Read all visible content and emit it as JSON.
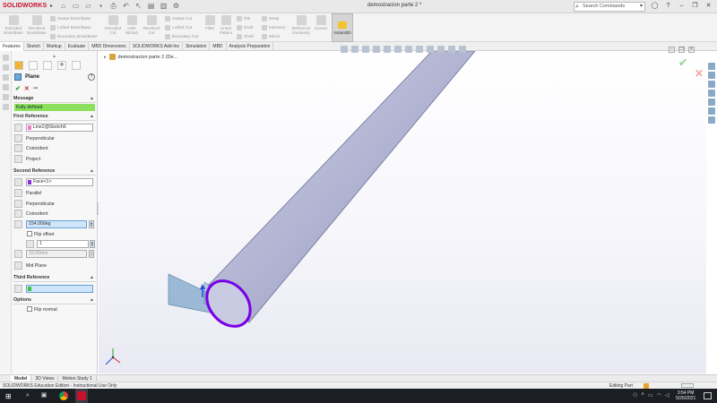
{
  "app": {
    "brand": "SOLIDWORKS",
    "document_title": "demostracion parte 2 *",
    "search_placeholder": "Search Commands"
  },
  "commands": {
    "extruded_boss": "Extruded Boss/Base",
    "revolved_boss": "Revolved Boss/Base",
    "swept_boss": "Swept Boss/Base",
    "lofted_boss": "Lofted Boss/Base",
    "boundary_boss": "Boundary Boss/Base",
    "extruded_cut": "Extruded Cut",
    "hole_wizard": "Hole Wizard",
    "revolved_cut": "Revolved Cut",
    "swept_cut": "Swept Cut",
    "lofted_cut": "Lofted Cut",
    "boundary_cut": "Boundary Cut",
    "fillet": "Fillet",
    "linear_pattern": "Linear Pattern",
    "rib": "Rib",
    "draft": "Draft",
    "shell": "Shell",
    "wrap": "Wrap",
    "intersect": "Intersect",
    "mirror": "Mirror",
    "reference_geometry": "Reference Geometry",
    "curves": "Curves",
    "instant3d": "Instant3D"
  },
  "tabs": [
    "Features",
    "Sketch",
    "Markup",
    "Evaluate",
    "MBD Dimensions",
    "SOLIDWORKS Add-Ins",
    "Simulation",
    "MBD",
    "Analysis Preparation"
  ],
  "property_manager": {
    "title": "Plane",
    "help": "?",
    "message_header": "Message",
    "message": "Fully defined",
    "first_reference": {
      "header": "First Reference",
      "selection": "Line2@Sketch6",
      "options": [
        "Perpendicular",
        "Coincident",
        "Project"
      ]
    },
    "second_reference": {
      "header": "Second Reference",
      "selection": "Face<1>",
      "options": [
        "Parallel",
        "Perpendicular",
        "Coincident"
      ],
      "angle": "154.00deg",
      "flip_offset": "Flip offset",
      "instances": "1",
      "distance": "10.00mm",
      "mid_plane": "Mid Plane"
    },
    "third_reference": {
      "header": "Third Reference",
      "selection": ""
    },
    "options": {
      "header": "Options",
      "flip_normal": "Flip normal"
    }
  },
  "feature_tree_flyout": "demostracion parte 2  (De...",
  "bottom_tabs": [
    "Model",
    "3D Views",
    "Motion Study 1"
  ],
  "status": {
    "left": "SOLIDWORKS Education Edition - Instructional Use Only",
    "right": "Editing Part"
  },
  "clock": {
    "time": "3:54 PM",
    "date": "5/26/2021"
  },
  "colors": {
    "message_bg": "#8be05c",
    "model_face": "#b5b8d6",
    "edge_highlight": "#7a00e6",
    "plane_preview": "#7fa7c9",
    "first_ref_swatch": "#f07ac7",
    "second_ref_swatch": "#8a2be2",
    "third_ref_swatch": "#3ec43e"
  }
}
